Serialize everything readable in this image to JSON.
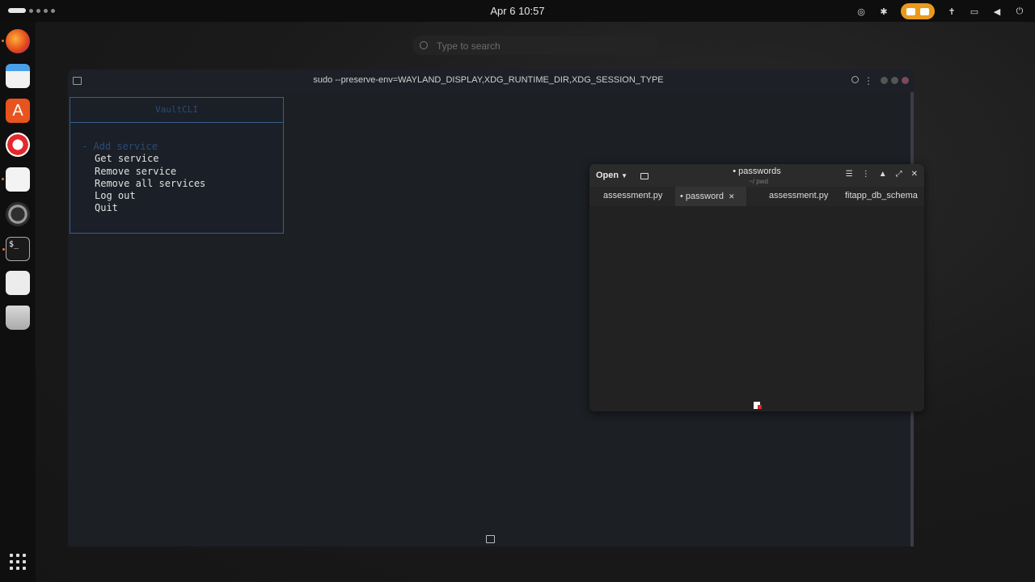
{
  "topbar": {
    "clock": "Apr 6  10:57"
  },
  "search": {
    "placeholder": "Type to search"
  },
  "terminal": {
    "title": "sudo --preserve-env=WAYLAND_DISPLAY,XDG_RUNTIME_DIR,XDG_SESSION_TYPE",
    "tui": {
      "title": "VaultCLI",
      "menu": [
        "- Add service",
        "Get service",
        "Remove service",
        "Remove all services",
        "Log out",
        "Quit"
      ]
    }
  },
  "editor": {
    "open_label": "Open",
    "title": "• passwords",
    "subtitle": "~/ pwd",
    "tabs": [
      "assessment.py",
      "• password",
      "assessment.py",
      "fitapp_db_schema"
    ]
  },
  "colors": {
    "accent": "#e99a1c",
    "tui_border": "#3a5d8c"
  }
}
